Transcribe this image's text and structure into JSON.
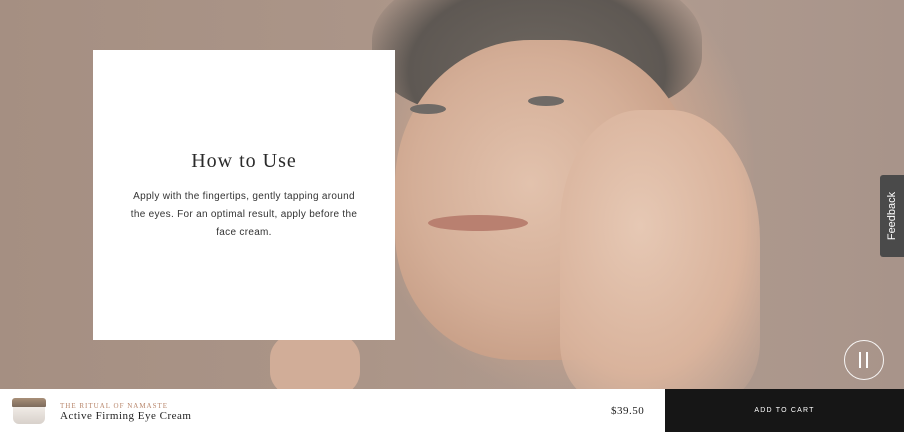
{
  "hero": {
    "image_description_icon": "woman-applying-eye-cream-image"
  },
  "howto": {
    "title": "How to Use",
    "body": "Apply with the fingertips, gently tapping around the eyes. For an optimal result, apply before the face cream."
  },
  "feedback": {
    "label": "Feedback"
  },
  "video_control": {
    "icon": "pause-icon"
  },
  "product_bar": {
    "collection": "THE RITUAL OF NAMASTE",
    "name": "Active Firming Eye Cream",
    "price": "$39.50",
    "add_to_cart_label": "ADD TO CART"
  },
  "colors": {
    "card_bg": "#ffffff",
    "cart_button_bg": "#161616",
    "collection_text": "#b8866b",
    "feedback_tab_bg": "#4a4a4a"
  }
}
